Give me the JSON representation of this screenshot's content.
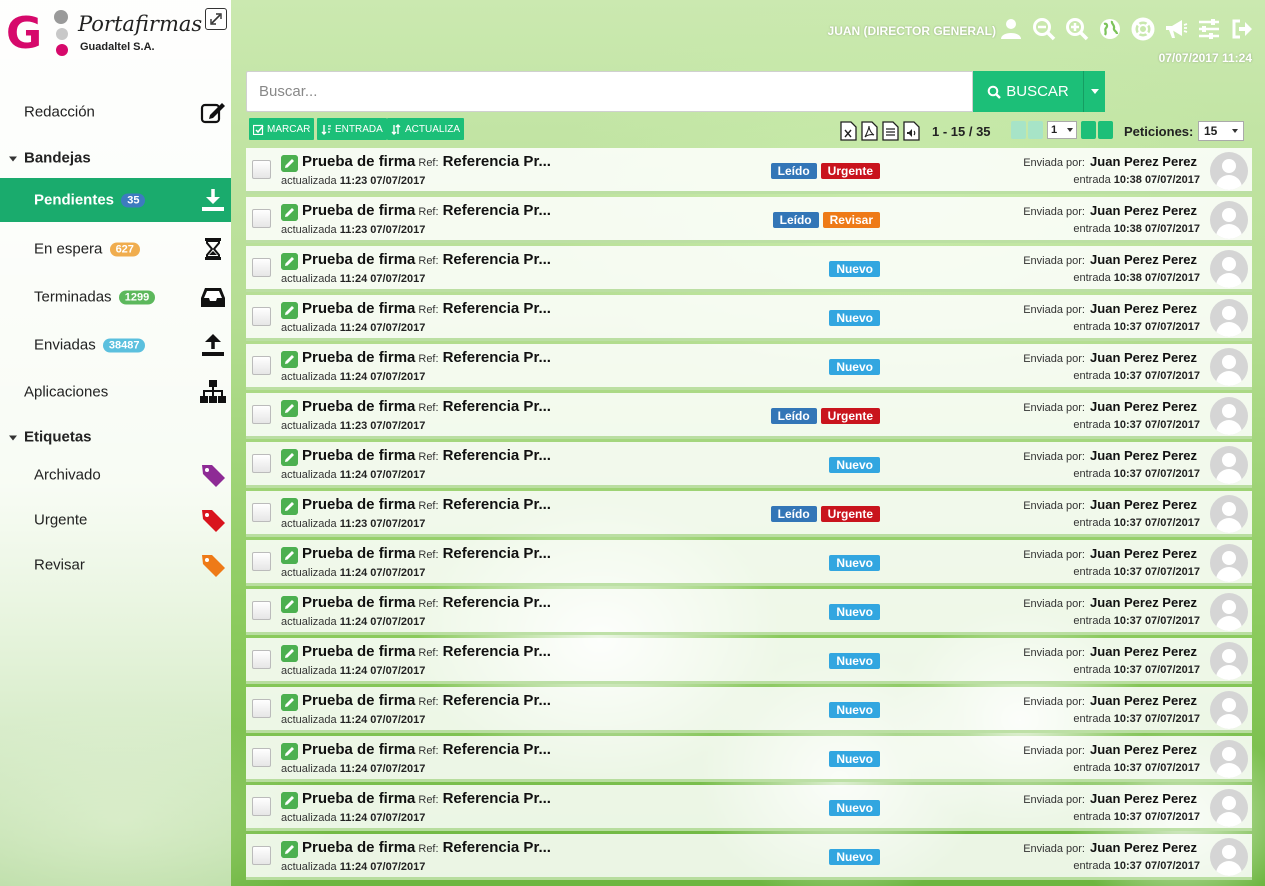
{
  "colors": {
    "accent": "#1cbf78",
    "active_nav": "#1aab6d",
    "tag_leido": "#3376b7",
    "tag_urgente": "#c9141d",
    "tag_revisar": "#ee7a17",
    "tag_nuevo": "#32a6e0",
    "count_pendientes": "#3d7bbf",
    "count_espera": "#f0ad4e",
    "count_terminadas": "#5cb85c",
    "count_enviadas": "#5bc0de",
    "label_archivado": "#8e2b95",
    "label_urgente": "#d9141d",
    "label_revisar": "#ee7a17"
  },
  "logo": {
    "letter": "G",
    "title": "Portafirmas",
    "subtitle": "Guadaltel S.A."
  },
  "sidebar": {
    "redaccion": "Redacción",
    "bandejas": "Bandejas",
    "pendientes": {
      "label": "Pendientes",
      "count": "35"
    },
    "espera": {
      "label": "En espera",
      "count": "627"
    },
    "terminadas": {
      "label": "Terminadas",
      "count": "1299"
    },
    "enviadas": {
      "label": "Enviadas",
      "count": "38487"
    },
    "aplicaciones": "Aplicaciones",
    "etiquetas": "Etiquetas",
    "archivado": "Archivado",
    "urgente": "Urgente",
    "revisar": "Revisar"
  },
  "header": {
    "user": "JUAN (DIRECTOR GENERAL)",
    "datetime": "07/07/2017 11:24",
    "icons": [
      "user-icon",
      "zoom-out-icon",
      "zoom-in-icon",
      "globe-icon",
      "help-icon",
      "announce-icon",
      "settings-icon",
      "logout-icon"
    ]
  },
  "search": {
    "placeholder": "Buscar...",
    "button": "BUSCAR"
  },
  "toolbar": {
    "marcar": "MARCAR",
    "entrada": "ENTRADA",
    "actualiza": "ACTUALIZA",
    "range": "1 - 15 / 35",
    "page": "1",
    "per_label": "Peticiones:",
    "per_value": "15"
  },
  "row_labels": {
    "ref": "Ref:",
    "actualizada": "actualizada",
    "enviada": "Enviada por:",
    "entrada": "entrada"
  },
  "requests": [
    {
      "title": "Prueba de firma",
      "ref": "Referencia Pr...",
      "updated": "11:23 07/07/2017",
      "sender": "Juan Perez Perez",
      "entry": "10:38 07/07/2017",
      "tags": [
        "Leído",
        "Urgente"
      ]
    },
    {
      "title": "Prueba de firma",
      "ref": "Referencia Pr...",
      "updated": "11:23 07/07/2017",
      "sender": "Juan Perez Perez",
      "entry": "10:38 07/07/2017",
      "tags": [
        "Leído",
        "Revisar"
      ]
    },
    {
      "title": "Prueba de firma",
      "ref": "Referencia Pr...",
      "updated": "11:24 07/07/2017",
      "sender": "Juan Perez Perez",
      "entry": "10:38 07/07/2017",
      "tags": [
        "Nuevo"
      ]
    },
    {
      "title": "Prueba de firma",
      "ref": "Referencia Pr...",
      "updated": "11:24 07/07/2017",
      "sender": "Juan Perez Perez",
      "entry": "10:37 07/07/2017",
      "tags": [
        "Nuevo"
      ]
    },
    {
      "title": "Prueba de firma",
      "ref": "Referencia Pr...",
      "updated": "11:24 07/07/2017",
      "sender": "Juan Perez Perez",
      "entry": "10:37 07/07/2017",
      "tags": [
        "Nuevo"
      ]
    },
    {
      "title": "Prueba de firma",
      "ref": "Referencia Pr...",
      "updated": "11:23 07/07/2017",
      "sender": "Juan Perez Perez",
      "entry": "10:37 07/07/2017",
      "tags": [
        "Leído",
        "Urgente"
      ]
    },
    {
      "title": "Prueba de firma",
      "ref": "Referencia Pr...",
      "updated": "11:24 07/07/2017",
      "sender": "Juan Perez Perez",
      "entry": "10:37 07/07/2017",
      "tags": [
        "Nuevo"
      ]
    },
    {
      "title": "Prueba de firma",
      "ref": "Referencia Pr...",
      "updated": "11:23 07/07/2017",
      "sender": "Juan Perez Perez",
      "entry": "10:37 07/07/2017",
      "tags": [
        "Leído",
        "Urgente"
      ]
    },
    {
      "title": "Prueba de firma",
      "ref": "Referencia Pr...",
      "updated": "11:24 07/07/2017",
      "sender": "Juan Perez Perez",
      "entry": "10:37 07/07/2017",
      "tags": [
        "Nuevo"
      ]
    },
    {
      "title": "Prueba de firma",
      "ref": "Referencia Pr...",
      "updated": "11:24 07/07/2017",
      "sender": "Juan Perez Perez",
      "entry": "10:37 07/07/2017",
      "tags": [
        "Nuevo"
      ]
    },
    {
      "title": "Prueba de firma",
      "ref": "Referencia Pr...",
      "updated": "11:24 07/07/2017",
      "sender": "Juan Perez Perez",
      "entry": "10:37 07/07/2017",
      "tags": [
        "Nuevo"
      ]
    },
    {
      "title": "Prueba de firma",
      "ref": "Referencia Pr...",
      "updated": "11:24 07/07/2017",
      "sender": "Juan Perez Perez",
      "entry": "10:37 07/07/2017",
      "tags": [
        "Nuevo"
      ]
    },
    {
      "title": "Prueba de firma",
      "ref": "Referencia Pr...",
      "updated": "11:24 07/07/2017",
      "sender": "Juan Perez Perez",
      "entry": "10:37 07/07/2017",
      "tags": [
        "Nuevo"
      ]
    },
    {
      "title": "Prueba de firma",
      "ref": "Referencia Pr...",
      "updated": "11:24 07/07/2017",
      "sender": "Juan Perez Perez",
      "entry": "10:37 07/07/2017",
      "tags": [
        "Nuevo"
      ]
    },
    {
      "title": "Prueba de firma",
      "ref": "Referencia Pr...",
      "updated": "11:24 07/07/2017",
      "sender": "Juan Perez Perez",
      "entry": "10:37 07/07/2017",
      "tags": [
        "Nuevo"
      ]
    }
  ]
}
